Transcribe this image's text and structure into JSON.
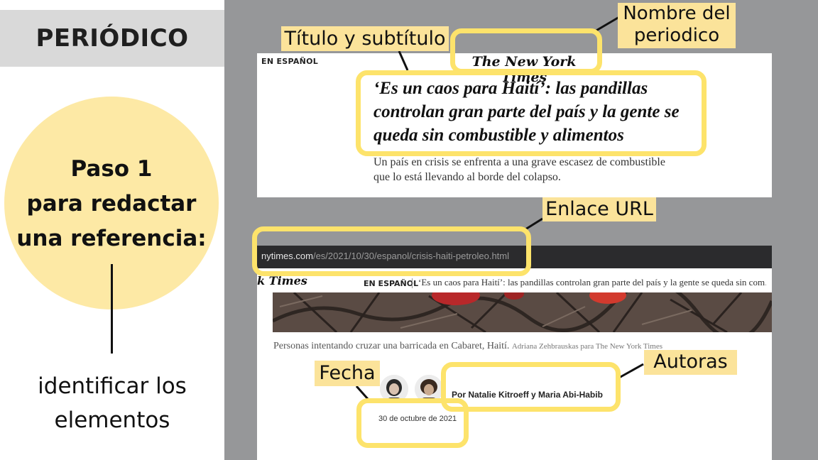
{
  "left_panel": {
    "header": "PERIÓDICO",
    "step_lines": [
      "Paso 1",
      "para redactar",
      "una referencia:"
    ],
    "desc_lines": [
      "identificar los",
      "elementos"
    ]
  },
  "article_top": {
    "section": "EN ESPAÑOL",
    "logo": "The New York Times",
    "headline": "‘Es un caos para Haití’: las pandillas controlan gran parte del país y la gente se queda sin combustible y alimentos",
    "subheadline": "Un país en crisis se enfrenta a una grave escasez de combustible que lo está llevando al borde del colapso."
  },
  "article_bottom": {
    "url_domain": "nytimes.com",
    "url_path": "/es/2021/10/30/espanol/crisis-haiti-petroleo.html",
    "logo": "k Times",
    "section": "EN ESPAÑOL",
    "headline_preview": "‘Es un caos para Haití’: las pandillas controlan gran parte del país y la gente se queda sin com…",
    "caption": "Personas intentando cruzar una barricada en Cabaret, Haití.",
    "credit": "Adriana Zehbrauskas para The New York Times",
    "byline": "Por Natalie Kitroeff y Maria Abi-Habib",
    "date": "30 de octubre de 2021"
  },
  "labels": {
    "newspaper_name": [
      "Nombre del",
      "periodico"
    ],
    "title_subtitle": "Título y subtítulo",
    "url_link": "Enlace URL",
    "date": "Fecha",
    "authors": "Autoras"
  },
  "colors": {
    "highlight": "#fde36b",
    "label_bg": "#fbe39a",
    "circle": "#fde9a5",
    "right_bg": "#969799",
    "header_band": "#d9d9d9"
  }
}
